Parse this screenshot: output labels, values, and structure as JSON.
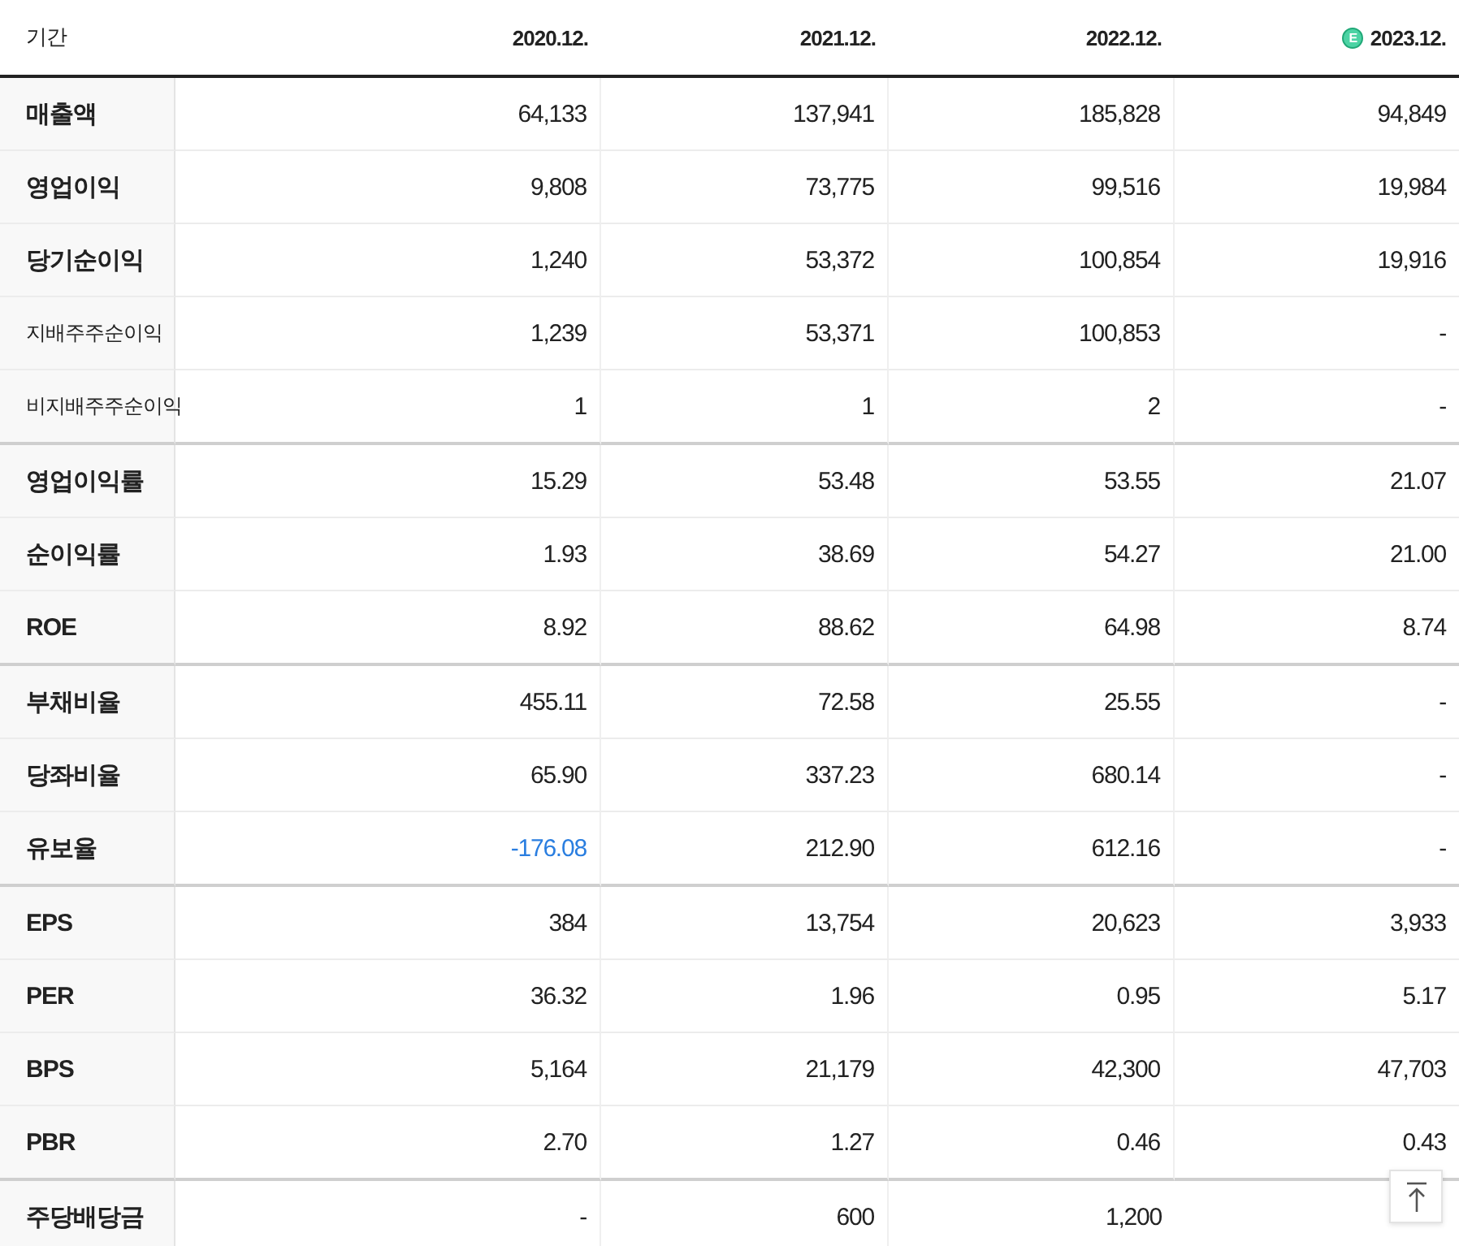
{
  "table": {
    "corner": "기간",
    "columns": [
      {
        "label": "2020.12.",
        "estimate": false
      },
      {
        "label": "2021.12.",
        "estimate": false
      },
      {
        "label": "2022.12.",
        "estimate": false
      },
      {
        "label": "2023.12.",
        "estimate": true,
        "badge": "E"
      }
    ],
    "rows": [
      {
        "label": "매출액",
        "kind": "main",
        "group_end": false,
        "values": [
          {
            "text": "64,133",
            "negative": false
          },
          {
            "text": "137,941",
            "negative": false
          },
          {
            "text": "185,828",
            "negative": false
          },
          {
            "text": "94,849",
            "negative": false
          }
        ]
      },
      {
        "label": "영업이익",
        "kind": "main",
        "group_end": false,
        "values": [
          {
            "text": "9,808",
            "negative": false
          },
          {
            "text": "73,775",
            "negative": false
          },
          {
            "text": "99,516",
            "negative": false
          },
          {
            "text": "19,984",
            "negative": false
          }
        ]
      },
      {
        "label": "당기순이익",
        "kind": "main",
        "group_end": false,
        "values": [
          {
            "text": "1,240",
            "negative": false
          },
          {
            "text": "53,372",
            "negative": false
          },
          {
            "text": "100,854",
            "negative": false
          },
          {
            "text": "19,916",
            "negative": false
          }
        ]
      },
      {
        "label": "지배주주순이익",
        "kind": "sub",
        "group_end": false,
        "values": [
          {
            "text": "1,239",
            "negative": false
          },
          {
            "text": "53,371",
            "negative": false
          },
          {
            "text": "100,853",
            "negative": false
          },
          {
            "text": "-",
            "negative": false
          }
        ]
      },
      {
        "label": "비지배주주순이익",
        "kind": "sub",
        "group_end": true,
        "values": [
          {
            "text": "1",
            "negative": false
          },
          {
            "text": "1",
            "negative": false
          },
          {
            "text": "2",
            "negative": false
          },
          {
            "text": "-",
            "negative": false
          }
        ]
      },
      {
        "label": "영업이익률",
        "kind": "main",
        "group_end": false,
        "values": [
          {
            "text": "15.29",
            "negative": false
          },
          {
            "text": "53.48",
            "negative": false
          },
          {
            "text": "53.55",
            "negative": false
          },
          {
            "text": "21.07",
            "negative": false
          }
        ]
      },
      {
        "label": "순이익률",
        "kind": "main",
        "group_end": false,
        "values": [
          {
            "text": "1.93",
            "negative": false
          },
          {
            "text": "38.69",
            "negative": false
          },
          {
            "text": "54.27",
            "negative": false
          },
          {
            "text": "21.00",
            "negative": false
          }
        ]
      },
      {
        "label": "ROE",
        "kind": "main",
        "group_end": true,
        "values": [
          {
            "text": "8.92",
            "negative": false
          },
          {
            "text": "88.62",
            "negative": false
          },
          {
            "text": "64.98",
            "negative": false
          },
          {
            "text": "8.74",
            "negative": false
          }
        ]
      },
      {
        "label": "부채비율",
        "kind": "main",
        "group_end": false,
        "values": [
          {
            "text": "455.11",
            "negative": false
          },
          {
            "text": "72.58",
            "negative": false
          },
          {
            "text": "25.55",
            "negative": false
          },
          {
            "text": "-",
            "negative": false
          }
        ]
      },
      {
        "label": "당좌비율",
        "kind": "main",
        "group_end": false,
        "values": [
          {
            "text": "65.90",
            "negative": false
          },
          {
            "text": "337.23",
            "negative": false
          },
          {
            "text": "680.14",
            "negative": false
          },
          {
            "text": "-",
            "negative": false
          }
        ]
      },
      {
        "label": "유보율",
        "kind": "main",
        "group_end": true,
        "values": [
          {
            "text": "-176.08",
            "negative": true
          },
          {
            "text": "212.90",
            "negative": false
          },
          {
            "text": "612.16",
            "negative": false
          },
          {
            "text": "-",
            "negative": false
          }
        ]
      },
      {
        "label": "EPS",
        "kind": "main",
        "group_end": false,
        "values": [
          {
            "text": "384",
            "negative": false
          },
          {
            "text": "13,754",
            "negative": false
          },
          {
            "text": "20,623",
            "negative": false
          },
          {
            "text": "3,933",
            "negative": false
          }
        ]
      },
      {
        "label": "PER",
        "kind": "main",
        "group_end": false,
        "values": [
          {
            "text": "36.32",
            "negative": false
          },
          {
            "text": "1.96",
            "negative": false
          },
          {
            "text": "0.95",
            "negative": false
          },
          {
            "text": "5.17",
            "negative": false
          }
        ]
      },
      {
        "label": "BPS",
        "kind": "main",
        "group_end": false,
        "values": [
          {
            "text": "5,164",
            "negative": false
          },
          {
            "text": "21,179",
            "negative": false
          },
          {
            "text": "42,300",
            "negative": false
          },
          {
            "text": "47,703",
            "negative": false
          }
        ]
      },
      {
        "label": "PBR",
        "kind": "main",
        "group_end": true,
        "values": [
          {
            "text": "2.70",
            "negative": false
          },
          {
            "text": "1.27",
            "negative": false
          },
          {
            "text": "0.46",
            "negative": false
          },
          {
            "text": "0.43",
            "negative": false
          }
        ]
      },
      {
        "label": "주당배당금",
        "kind": "main",
        "group_end": false,
        "values": [
          {
            "text": "-",
            "negative": false
          },
          {
            "text": "600",
            "negative": false
          },
          {
            "text": "1,200",
            "negative": false
          }
        ]
      }
    ]
  }
}
